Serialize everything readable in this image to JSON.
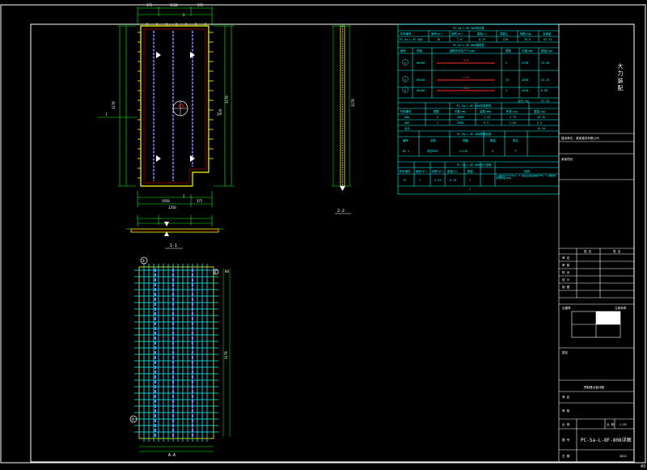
{
  "drawing": {
    "section_1_label": "1-1",
    "section_2_label": "2-2",
    "section_marker_1": "1",
    "section_marker_2": "2",
    "panel_dims": {
      "top_dims": [
        "375",
        "1350",
        "375"
      ],
      "bottom_dims": [
        "1950",
        "375",
        "1350"
      ],
      "right_dims": [
        "3178",
        "820",
        "3178"
      ],
      "left_height": "3178"
    },
    "rebar_plan_labels": {
      "circle_top": "①",
      "circle_mid": "②",
      "circle_bottom": "③",
      "right_dim": "60"
    },
    "bottom_caption": "A-A"
  },
  "tables": {
    "t1": {
      "title": "PC-5a-L-8F-808构件表",
      "headers": [
        "构件编号",
        "面积(m²)",
        "体积(m³)",
        "重量(t)",
        "混凝土",
        "钢筋(kg)",
        "含钢量"
      ],
      "row": [
        "PC-5a-L-8F-808",
        "18",
        "7.0",
        "0.29",
        "C30",
        "26.8",
        "92.74"
      ]
    },
    "t2": {
      "title": "PC-5a-L-8F-808钢筋表",
      "headers": [
        "编号",
        "规格",
        "钢筋形状及尺寸(mm)",
        "根数",
        "长度(mm)",
        "重量(kg)"
      ],
      "rows": [
        {
          "no": "①",
          "spec": "8@150",
          "shape": "2010",
          "count": "5",
          "len": "3178",
          "wt": "23.98"
        },
        {
          "no": "②",
          "spec": "8@150",
          "shape": "3178",
          "count": "15",
          "len": "2010",
          "wt": "25.15"
        },
        {
          "no": "③",
          "spec": "8@150",
          "shape": "1950",
          "count": "4",
          "len": "2010",
          "wt": "8.80"
        }
      ],
      "total_label": "合计(kg)",
      "total": "57.93"
    },
    "t3": {
      "title": "PC-5a-L-8F-808桁架筋表",
      "headers": [
        "桁架编号",
        "根数",
        "长度(mm)",
        "高度(mm)",
        "桁架(kg)",
        "重量(kg)"
      ],
      "rows": [
        [
          "A80",
          "2",
          "2850",
          "1.33",
          "3.79",
          "10.76"
        ],
        [
          "A80",
          "1",
          "2850",
          "0.5",
          "2.85",
          "5.5"
        ],
        [
          "合计",
          "",
          "",
          "",
          "",
          "16.26"
        ]
      ]
    },
    "t4": {
      "title": "PC-5a-L-8F-808预埋件表",
      "headers": [
        "编号",
        "名称",
        "规格",
        "数量",
        "单位"
      ],
      "row": [
        "MJ-1",
        "吊钉M20",
        "L=120",
        "4",
        "个"
      ]
    },
    "t5": {
      "title": "PC-5a-L-8F-808设计说明",
      "headers": [
        "构件编号",
        "面积(m²)",
        "体积(m³)",
        "重量(t)",
        "数量",
        "说明"
      ],
      "row": [
        "1F",
        "1",
        "2.91",
        "0.29",
        "1",
        "1.图中尺寸以mm计，2.混凝土强度等级C30；3.钢筋保护层厚度15mm"
      ],
      "row2_num": "1"
    }
  },
  "titleblock": {
    "company": "大\n力\n装\n配",
    "project_line": "建设单位：某某建设有限公司",
    "project_name": "某某项目",
    "table_headers": [
      "姓 名",
      "签 名"
    ],
    "roles": [
      "审 定",
      "审 核",
      "校 对",
      "设 计",
      "制 图"
    ],
    "stamp_label": "出图章",
    "stamp_right": "注册师章",
    "drawing_label": "图名",
    "subject": "预制叠合板详图",
    "scale_label": "比 例",
    "scale_value": "1:25",
    "sheet_no_label": "图 号",
    "drawing_no": "PC-5a-L-8F-808详图",
    "date_label": "日 期",
    "date_value": "2023",
    "page_no": "43"
  },
  "colors": {
    "frame": "#ffffff",
    "table": "#00ffff",
    "dim": "#00ff00",
    "panel": "#ffff00",
    "rebar": "#8080ff",
    "hatch": "#ff0000"
  }
}
